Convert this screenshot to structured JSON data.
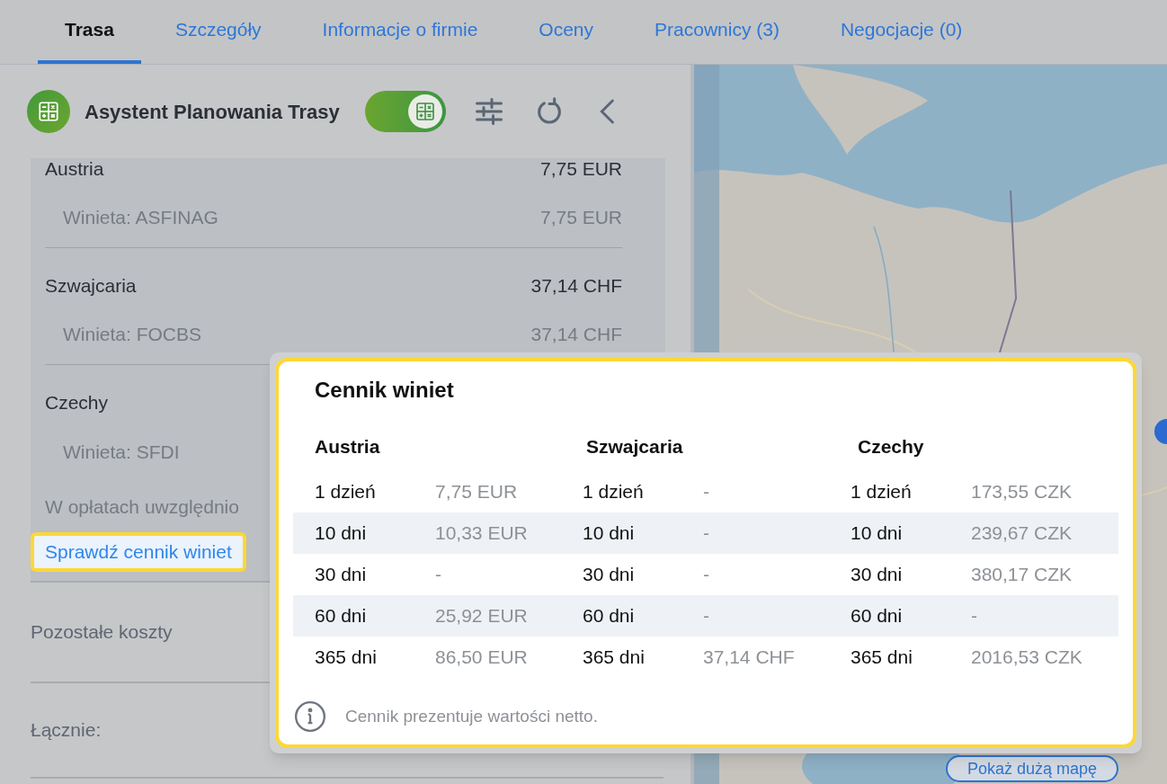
{
  "tabs": [
    {
      "label": "Trasa",
      "selected": true
    },
    {
      "label": "Szczegóły",
      "selected": false
    },
    {
      "label": "Informacje o firmie",
      "selected": false
    },
    {
      "label": "Oceny",
      "selected": false
    },
    {
      "label": "Pracownicy (3)",
      "selected": false
    },
    {
      "label": "Negocjacje (0)",
      "selected": false
    }
  ],
  "assistant": {
    "title": "Asystent Planowania Trasy",
    "toggle_on": true
  },
  "vignette_costs": [
    {
      "country": "Austria",
      "amount": "7,75 EUR",
      "items": [
        {
          "label": "Winieta: ASFINAG",
          "amount": "7,75 EUR"
        }
      ]
    },
    {
      "country": "Szwajcaria",
      "amount": "37,14 CHF",
      "items": [
        {
          "label": "Winieta: FOCBS",
          "amount": "37,14 CHF"
        }
      ]
    },
    {
      "country": "Czechy",
      "items": [
        {
          "label": "Winieta: SFDI"
        }
      ]
    }
  ],
  "fees_note": "W opłatach uwzględnio",
  "price_list_link": "Sprawdź cennik winiet",
  "other_costs_label": "Pozostałe koszty",
  "total_label": "Łącznie:",
  "map_button": "Pokaż dużą mapę",
  "popup": {
    "title": "Cennik winiet",
    "countries": [
      {
        "name": "Austria",
        "rows": [
          {
            "period": "1 dzień",
            "price": "7,75 EUR"
          },
          {
            "period": "10 dni",
            "price": "10,33 EUR"
          },
          {
            "period": "30 dni",
            "price": "-"
          },
          {
            "period": "60 dni",
            "price": "25,92 EUR"
          },
          {
            "period": "365 dni",
            "price": "86,50 EUR"
          }
        ]
      },
      {
        "name": "Szwajcaria",
        "rows": [
          {
            "period": "1 dzień",
            "price": "-"
          },
          {
            "period": "10 dni",
            "price": "-"
          },
          {
            "period": "30 dni",
            "price": "-"
          },
          {
            "period": "60 dni",
            "price": "-"
          },
          {
            "period": "365 dni",
            "price": "37,14 CHF"
          }
        ]
      },
      {
        "name": "Czechy",
        "rows": [
          {
            "period": "1 dzień",
            "price": "173,55 CZK"
          },
          {
            "period": "10 dni",
            "price": "239,67 CZK"
          },
          {
            "period": "30 dni",
            "price": "380,17 CZK"
          },
          {
            "period": "60 dni",
            "price": "-"
          },
          {
            "period": "365 dni",
            "price": "2016,53 CZK"
          }
        ]
      }
    ],
    "footnote": "Cennik prezentuje wartości netto."
  }
}
